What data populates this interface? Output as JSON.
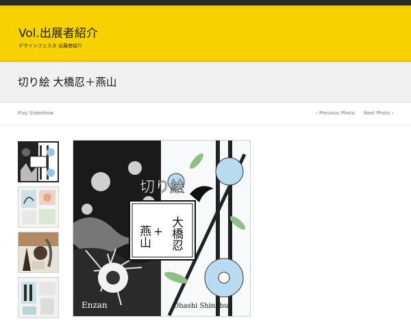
{
  "site": {
    "title": "Vol.出展者紹介",
    "subtitle": "デザインフェスタ 出展者紹介"
  },
  "page": {
    "title": "切り絵 大橋忍＋燕山"
  },
  "controls": {
    "play": "Play Slideshow",
    "prev": "‹ Previous Photo",
    "next": "Next Photo ›"
  },
  "artwork": {
    "banner": "切り絵",
    "left_name": "燕山",
    "right_name": "大橋忍",
    "plus": "+",
    "left_signature": "Enzan",
    "right_signature": "Ohashi Shinobu"
  },
  "colors": {
    "header": "#f7d100",
    "topbar": "#2b2b2b",
    "title_band": "#f1f1f1"
  }
}
